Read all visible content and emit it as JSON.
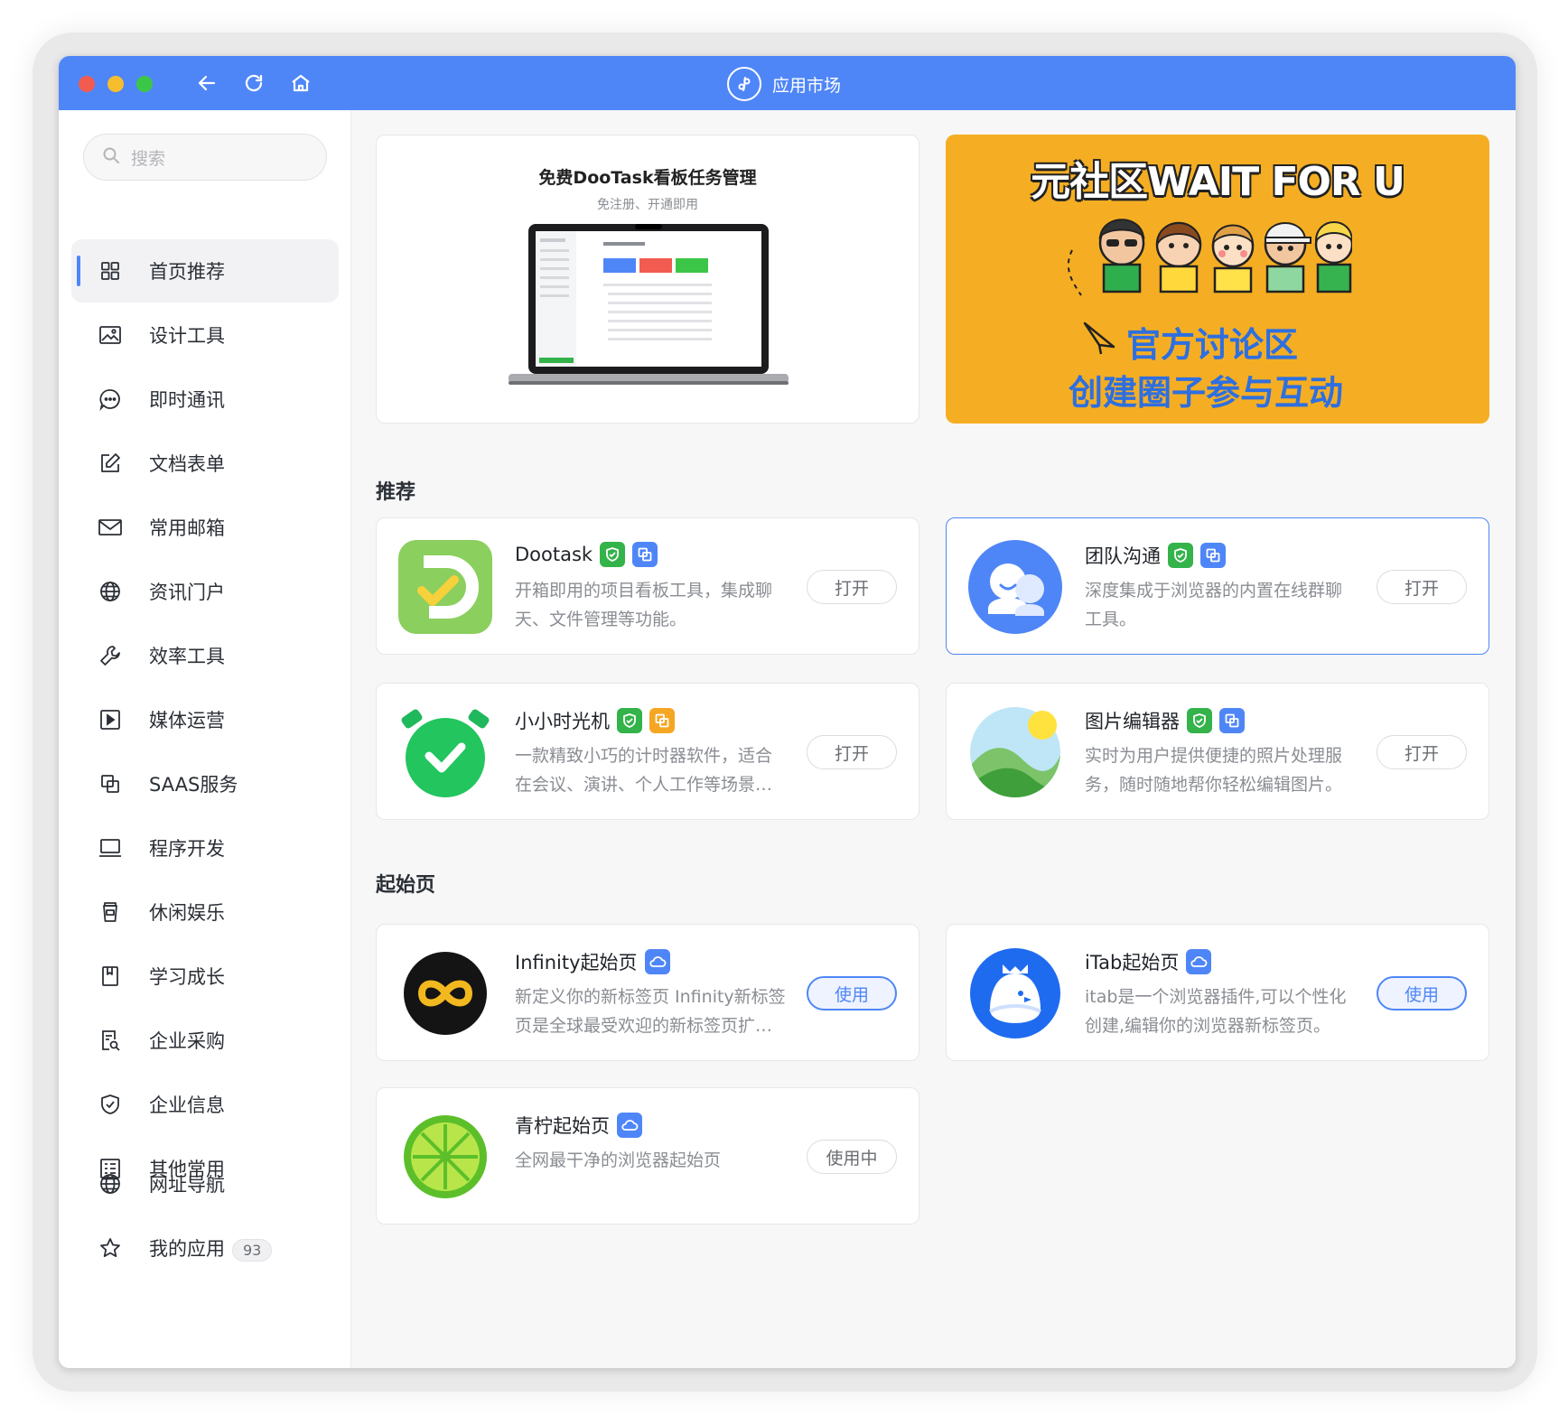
{
  "window": {
    "title": "应用市场"
  },
  "search": {
    "placeholder": "搜索"
  },
  "sidebar": {
    "items": [
      {
        "label": "首页推荐",
        "icon": "grid-icon",
        "active": true
      },
      {
        "label": "设计工具",
        "icon": "image-icon"
      },
      {
        "label": "即时通讯",
        "icon": "chat-bubble-icon"
      },
      {
        "label": "文档表单",
        "icon": "edit-doc-icon"
      },
      {
        "label": "常用邮箱",
        "icon": "mail-icon"
      },
      {
        "label": "资讯门户",
        "icon": "globe-icon"
      },
      {
        "label": "效率工具",
        "icon": "wrench-icon"
      },
      {
        "label": "媒体运营",
        "icon": "play-icon"
      },
      {
        "label": "SAAS服务",
        "icon": "copy-icon"
      },
      {
        "label": "程序开发",
        "icon": "laptop-icon"
      },
      {
        "label": "休闲娱乐",
        "icon": "cup-icon"
      },
      {
        "label": "学习成长",
        "icon": "bookmark-icon"
      },
      {
        "label": "企业采购",
        "icon": "doc-search-icon"
      },
      {
        "label": "企业信息",
        "icon": "shield-icon"
      },
      {
        "label": "其他常用",
        "icon": "list-icon"
      }
    ],
    "bottom": [
      {
        "label": "网址导航",
        "icon": "globe-icon"
      },
      {
        "label": "我的应用",
        "icon": "star-icon",
        "badge": "93"
      }
    ]
  },
  "banners": {
    "left": {
      "title": "免费DooTask看板任务管理",
      "subtitle": "免注册、开通即用"
    },
    "right": {
      "title": "元社区WAIT FOR U",
      "line1": "官方讨论区",
      "line2": "创建圈子参与互动"
    }
  },
  "sections": {
    "recommend": {
      "title": "推荐"
    },
    "startpage": {
      "title": "起始页"
    }
  },
  "cards": [
    {
      "name": "Dootask",
      "desc": "开箱即用的项目看板工具，集成聊天、文件管理等功能。",
      "button": "打开",
      "icon": "dootask-icon",
      "tags": [
        "green",
        "blue"
      ]
    },
    {
      "name": "团队沟通",
      "desc": "深度集成于浏览器的内置在线群聊工具。",
      "button": "打开",
      "icon": "team-chat-icon",
      "tags": [
        "green",
        "blue"
      ]
    },
    {
      "name": "小小时光机",
      "desc": "一款精致小巧的计时器软件，适合在会议、演讲、个人工作等场景中使用。",
      "button": "打开",
      "icon": "timer-icon",
      "tags": [
        "green",
        "orange"
      ]
    },
    {
      "name": "图片编辑器",
      "desc": "实时为用户提供便捷的照片处理服务，随时随地帮你轻松编辑图片。",
      "button": "打开",
      "icon": "photo-editor-icon",
      "tags": [
        "green",
        "blue"
      ]
    },
    {
      "name": "Infinity起始页",
      "desc": "新定义你的新标签页 Infinity新标签页是全球最受欢迎的新标签页扩展之一。",
      "button": "使用",
      "icon": "infinity-icon",
      "tags": [
        "blue"
      ]
    },
    {
      "name": "iTab起始页",
      "desc": "itab是一个浏览器插件,可以个性化创建,编辑你的浏览器新标签页。",
      "button": "使用",
      "icon": "itab-icon",
      "tags": [
        "blue"
      ]
    },
    {
      "name": "青柠起始页",
      "desc": "全网最干净的浏览器起始页",
      "button": "使用中",
      "icon": "lime-icon",
      "tags": [
        "blue"
      ]
    }
  ],
  "colors": {
    "accent": "#4f86f7",
    "banner_orange": "#f5ae23",
    "tag_green": "#33b34a"
  }
}
